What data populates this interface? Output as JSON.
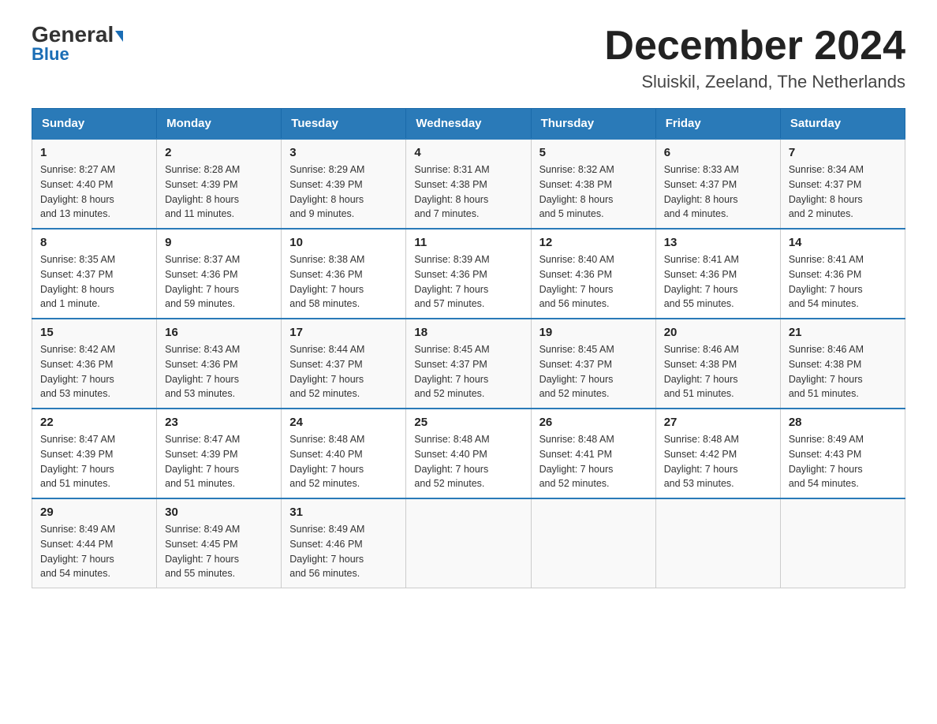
{
  "header": {
    "logo_general": "General",
    "logo_blue": "Blue",
    "month_title": "December 2024",
    "location": "Sluiskil, Zeeland, The Netherlands"
  },
  "weekdays": [
    "Sunday",
    "Monday",
    "Tuesday",
    "Wednesday",
    "Thursday",
    "Friday",
    "Saturday"
  ],
  "weeks": [
    [
      {
        "day": "1",
        "info": "Sunrise: 8:27 AM\nSunset: 4:40 PM\nDaylight: 8 hours\nand 13 minutes."
      },
      {
        "day": "2",
        "info": "Sunrise: 8:28 AM\nSunset: 4:39 PM\nDaylight: 8 hours\nand 11 minutes."
      },
      {
        "day": "3",
        "info": "Sunrise: 8:29 AM\nSunset: 4:39 PM\nDaylight: 8 hours\nand 9 minutes."
      },
      {
        "day": "4",
        "info": "Sunrise: 8:31 AM\nSunset: 4:38 PM\nDaylight: 8 hours\nand 7 minutes."
      },
      {
        "day": "5",
        "info": "Sunrise: 8:32 AM\nSunset: 4:38 PM\nDaylight: 8 hours\nand 5 minutes."
      },
      {
        "day": "6",
        "info": "Sunrise: 8:33 AM\nSunset: 4:37 PM\nDaylight: 8 hours\nand 4 minutes."
      },
      {
        "day": "7",
        "info": "Sunrise: 8:34 AM\nSunset: 4:37 PM\nDaylight: 8 hours\nand 2 minutes."
      }
    ],
    [
      {
        "day": "8",
        "info": "Sunrise: 8:35 AM\nSunset: 4:37 PM\nDaylight: 8 hours\nand 1 minute."
      },
      {
        "day": "9",
        "info": "Sunrise: 8:37 AM\nSunset: 4:36 PM\nDaylight: 7 hours\nand 59 minutes."
      },
      {
        "day": "10",
        "info": "Sunrise: 8:38 AM\nSunset: 4:36 PM\nDaylight: 7 hours\nand 58 minutes."
      },
      {
        "day": "11",
        "info": "Sunrise: 8:39 AM\nSunset: 4:36 PM\nDaylight: 7 hours\nand 57 minutes."
      },
      {
        "day": "12",
        "info": "Sunrise: 8:40 AM\nSunset: 4:36 PM\nDaylight: 7 hours\nand 56 minutes."
      },
      {
        "day": "13",
        "info": "Sunrise: 8:41 AM\nSunset: 4:36 PM\nDaylight: 7 hours\nand 55 minutes."
      },
      {
        "day": "14",
        "info": "Sunrise: 8:41 AM\nSunset: 4:36 PM\nDaylight: 7 hours\nand 54 minutes."
      }
    ],
    [
      {
        "day": "15",
        "info": "Sunrise: 8:42 AM\nSunset: 4:36 PM\nDaylight: 7 hours\nand 53 minutes."
      },
      {
        "day": "16",
        "info": "Sunrise: 8:43 AM\nSunset: 4:36 PM\nDaylight: 7 hours\nand 53 minutes."
      },
      {
        "day": "17",
        "info": "Sunrise: 8:44 AM\nSunset: 4:37 PM\nDaylight: 7 hours\nand 52 minutes."
      },
      {
        "day": "18",
        "info": "Sunrise: 8:45 AM\nSunset: 4:37 PM\nDaylight: 7 hours\nand 52 minutes."
      },
      {
        "day": "19",
        "info": "Sunrise: 8:45 AM\nSunset: 4:37 PM\nDaylight: 7 hours\nand 52 minutes."
      },
      {
        "day": "20",
        "info": "Sunrise: 8:46 AM\nSunset: 4:38 PM\nDaylight: 7 hours\nand 51 minutes."
      },
      {
        "day": "21",
        "info": "Sunrise: 8:46 AM\nSunset: 4:38 PM\nDaylight: 7 hours\nand 51 minutes."
      }
    ],
    [
      {
        "day": "22",
        "info": "Sunrise: 8:47 AM\nSunset: 4:39 PM\nDaylight: 7 hours\nand 51 minutes."
      },
      {
        "day": "23",
        "info": "Sunrise: 8:47 AM\nSunset: 4:39 PM\nDaylight: 7 hours\nand 51 minutes."
      },
      {
        "day": "24",
        "info": "Sunrise: 8:48 AM\nSunset: 4:40 PM\nDaylight: 7 hours\nand 52 minutes."
      },
      {
        "day": "25",
        "info": "Sunrise: 8:48 AM\nSunset: 4:40 PM\nDaylight: 7 hours\nand 52 minutes."
      },
      {
        "day": "26",
        "info": "Sunrise: 8:48 AM\nSunset: 4:41 PM\nDaylight: 7 hours\nand 52 minutes."
      },
      {
        "day": "27",
        "info": "Sunrise: 8:48 AM\nSunset: 4:42 PM\nDaylight: 7 hours\nand 53 minutes."
      },
      {
        "day": "28",
        "info": "Sunrise: 8:49 AM\nSunset: 4:43 PM\nDaylight: 7 hours\nand 54 minutes."
      }
    ],
    [
      {
        "day": "29",
        "info": "Sunrise: 8:49 AM\nSunset: 4:44 PM\nDaylight: 7 hours\nand 54 minutes."
      },
      {
        "day": "30",
        "info": "Sunrise: 8:49 AM\nSunset: 4:45 PM\nDaylight: 7 hours\nand 55 minutes."
      },
      {
        "day": "31",
        "info": "Sunrise: 8:49 AM\nSunset: 4:46 PM\nDaylight: 7 hours\nand 56 minutes."
      },
      {
        "day": "",
        "info": ""
      },
      {
        "day": "",
        "info": ""
      },
      {
        "day": "",
        "info": ""
      },
      {
        "day": "",
        "info": ""
      }
    ]
  ]
}
